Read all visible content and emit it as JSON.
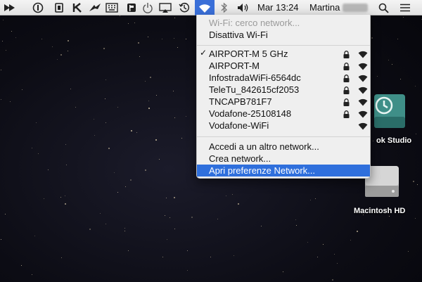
{
  "menubar": {
    "clock": "Mar 13:24",
    "user": "Martina",
    "icons": [
      "arrow-icon",
      "info-icon",
      "chip-icon",
      "k-icon",
      "bird-icon",
      "keyboard-icon",
      "flag-icon",
      "power-icon",
      "airplay-icon",
      "time-machine-icon",
      "wifi-icon",
      "bluetooth-icon",
      "volume-icon",
      "search-icon",
      "list-icon"
    ]
  },
  "wifi_menu": {
    "status": "Wi-Fi: cerco network...",
    "toggle": "Disattiva Wi-Fi",
    "networks": [
      {
        "name": "AIRPORT-M 5 GHz",
        "connected": true,
        "locked": true
      },
      {
        "name": "AIRPORT-M",
        "connected": false,
        "locked": true
      },
      {
        "name": "InfostradaWiFi-6564dc",
        "connected": false,
        "locked": true
      },
      {
        "name": "TeleTu_842615cf2053",
        "connected": false,
        "locked": true
      },
      {
        "name": "TNCAPB781F7",
        "connected": false,
        "locked": true
      },
      {
        "name": "Vodafone-25108148",
        "connected": false,
        "locked": true
      },
      {
        "name": "Vodafone-WiFi",
        "connected": false,
        "locked": false
      }
    ],
    "actions": [
      "Accedi a un altro network...",
      "Crea network...",
      "Apri preferenze Network..."
    ],
    "checkmark": "✓"
  },
  "desktop": {
    "icons": [
      {
        "label": "ok Studio"
      },
      {
        "label": "Macintosh HD"
      }
    ]
  }
}
